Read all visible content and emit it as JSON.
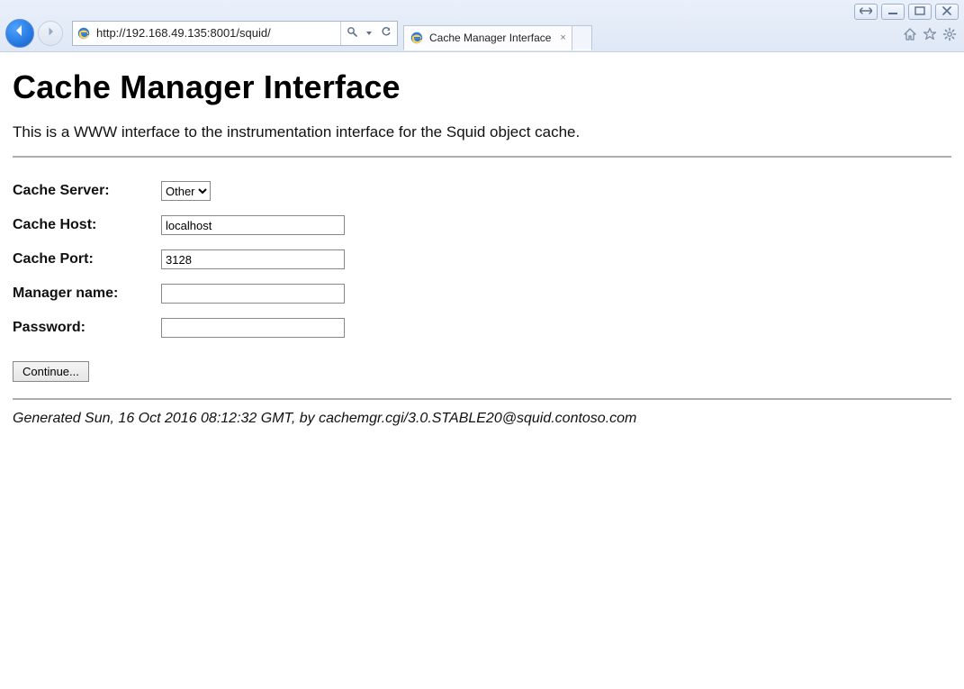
{
  "window": {
    "url": "http://192.168.49.135:8001/squid/",
    "url_highlight": "192.168.49.135",
    "tab_title": "Cache Manager Interface",
    "controls": {
      "swap": "⇔",
      "min": "—",
      "max": "▢",
      "close": "✕"
    },
    "icons": {
      "search": "search-icon",
      "refresh": "refresh-icon",
      "home": "home-icon",
      "fav": "star-icon",
      "gear": "gear-icon"
    }
  },
  "page": {
    "title": "Cache Manager Interface",
    "intro": "This is a WWW interface to the instrumentation interface for the Squid object cache.",
    "form": {
      "server_label": "Cache Server:",
      "server_value": "Other",
      "host_label": "Cache Host:",
      "host_value": "localhost",
      "port_label": "Cache Port:",
      "port_value": "3128",
      "manager_label": "Manager name:",
      "manager_value": "",
      "password_label": "Password:",
      "password_value": "",
      "continue_label": "Continue..."
    },
    "footer": "Generated Sun, 16 Oct 2016 08:12:32 GMT, by cachemgr.cgi/3.0.STABLE20@squid.contoso.com"
  }
}
